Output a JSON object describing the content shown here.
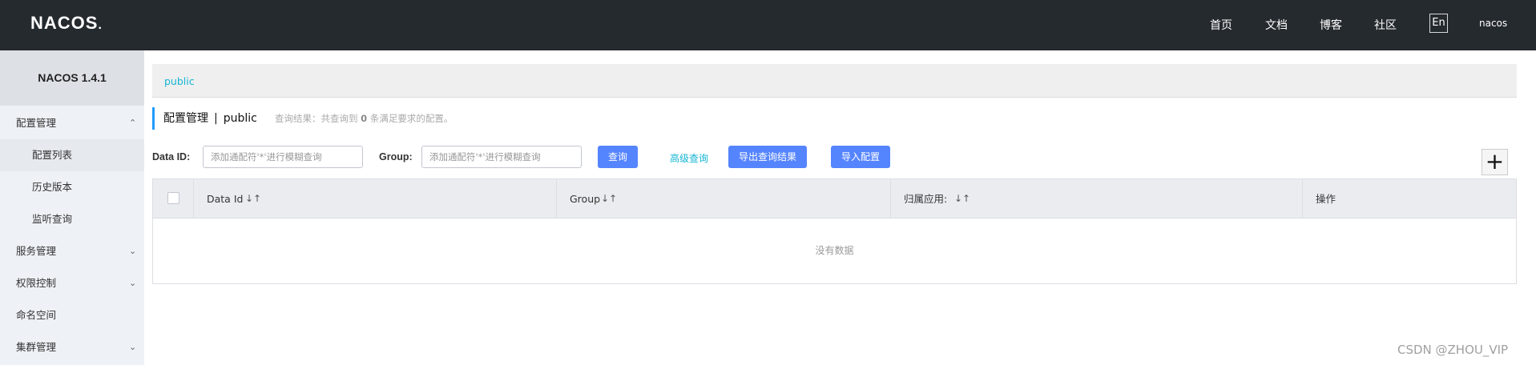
{
  "header": {
    "logo": "NACOS",
    "logo_dot": ".",
    "nav": [
      "首页",
      "文档",
      "博客",
      "社区"
    ],
    "lang": "En",
    "user": "nacos"
  },
  "sidebar": {
    "title": "NACOS 1.4.1",
    "items": [
      {
        "label": "配置管理",
        "chevron": "⌃"
      },
      {
        "label": "配置列表"
      },
      {
        "label": "历史版本"
      },
      {
        "label": "监听查询"
      },
      {
        "label": "服务管理",
        "chevron": "⌄"
      },
      {
        "label": "权限控制",
        "chevron": "⌄"
      },
      {
        "label": "命名空间"
      },
      {
        "label": "集群管理",
        "chevron": "⌄"
      }
    ]
  },
  "main": {
    "namespace_tab": "public",
    "title": "配置管理",
    "title_sep": "|",
    "title_ns": "public",
    "query_result_prefix": "查询结果：共查询到",
    "query_result_count": "0",
    "query_result_suffix": "条满足要求的配置。",
    "data_id_label": "Data ID:",
    "data_id_placeholder": "添加通配符'*'进行模糊查询",
    "group_label": "Group:",
    "group_placeholder": "添加通配符'*'进行模糊查询",
    "query_button": "查询",
    "advanced_query": "高级查询",
    "export_button": "导出查询结果",
    "import_button": "导入配置",
    "add_button": "+"
  },
  "table": {
    "columns": [
      "Data Id",
      "Group",
      "归属应用:",
      "操作"
    ],
    "sort_icon": "↓↑",
    "empty_text": "没有数据"
  },
  "watermark": "CSDN @ZHOU_VIP",
  "colors": {
    "header_bg": "#252a2f",
    "primary": "#5584ff",
    "link": "#14b5d4"
  }
}
